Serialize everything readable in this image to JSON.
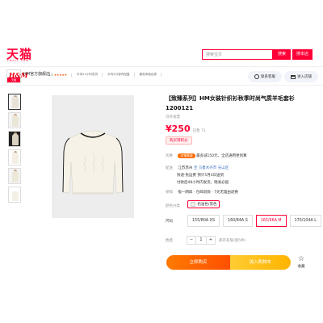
{
  "header": {
    "logo": "天猫",
    "logo_sub": "TMALL.COM",
    "search_placeholder": "搜索宝贝",
    "search_button": "搜索",
    "search_store_button": "搜本店"
  },
  "store": {
    "logo_text": "H&M",
    "logo_badge": "天猫",
    "name": "HM官方旗舰店",
    "rating": "5.0",
    "stars": "★★★★★",
    "metrics": [
      "平均21小时发货",
      "平均2分钟内回复",
      "服务体验优秀"
    ],
    "contact_button": "联系客服",
    "enter_store_button": "进入店铺"
  },
  "product": {
    "title": "【致臻系列】HM女装针织衫秋季时尚气质羊毛套衫1200121",
    "coupon_note": "可开发票",
    "price": "¥250",
    "sold": "已售 71",
    "points_tag": "购买得积分",
    "promo_label": "优惠",
    "promo_badge": "店铺满减",
    "promo_text": "最多减150元，全店通用更划算",
    "delivery_label": "配送",
    "ship_from": "江苏苏州",
    "ship_to": "至 乌鲁木齐市 天山区",
    "delivery_time": "快递·免运费  预计5月4日送到",
    "shipping_extra": "付款后48小时内发货，晚发必赔",
    "service_label": "保障",
    "service_text": "极一网四 · 包邮退款 · 7天无理由退换",
    "color_label": "颜色分类",
    "selected_color": "奶油色/黑色",
    "size_label": "尺码",
    "sizes": [
      "155/80A XS",
      "160/84A S",
      "165/96A M",
      "170/104A L"
    ],
    "selected_size_index": 2,
    "qty_label": "数量",
    "qty_minus": "−",
    "qty_value": "1",
    "qty_plus": "+",
    "qty_note": "库存有限(限5件)",
    "buy_now": "立即购买",
    "add_to_cart": "加入购物车",
    "favorite": "收藏",
    "favorite_icon": "☆"
  }
}
